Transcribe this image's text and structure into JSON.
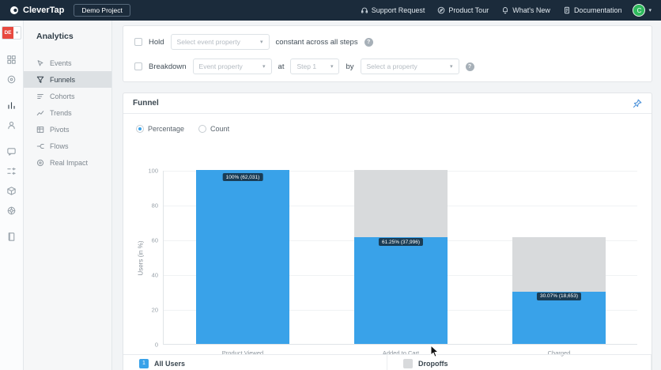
{
  "colors": {
    "topbar_bg": "#1b2b3b",
    "bar_blue": "#39a2e9",
    "bar_gray": "#d8dadc",
    "badge_red": "#e8493f",
    "avatar_green": "#2fb95d"
  },
  "topbar": {
    "logo_text": "CleverTap",
    "project_button": "Demo Project",
    "links": [
      {
        "label": "Support Request",
        "icon": "headset-icon"
      },
      {
        "label": "Product Tour",
        "icon": "compass-icon"
      },
      {
        "label": "What's New",
        "icon": "bell-icon"
      },
      {
        "label": "Documentation",
        "icon": "document-icon"
      }
    ],
    "avatar_initial": "C"
  },
  "rail": {
    "account_badge": "DE"
  },
  "sidebar": {
    "title": "Analytics",
    "items": [
      {
        "label": "Events"
      },
      {
        "label": "Funnels"
      },
      {
        "label": "Cohorts"
      },
      {
        "label": "Trends"
      },
      {
        "label": "Pivots"
      },
      {
        "label": "Flows"
      },
      {
        "label": "Real Impact"
      }
    ]
  },
  "filters": {
    "hold": {
      "label": "Hold",
      "placeholder": "Select event property",
      "suffix": "constant across all steps"
    },
    "breakdown": {
      "label": "Breakdown",
      "placeholder1": "Event property",
      "at": "at",
      "placeholder2": "Step 1",
      "by": "by",
      "placeholder3": "Select a property"
    }
  },
  "funnel_card": {
    "title": "Funnel",
    "radios": [
      {
        "label": "Percentage",
        "selected": true
      },
      {
        "label": "Count",
        "selected": false
      }
    ],
    "legend": [
      {
        "badge": "1",
        "label": "All Users"
      },
      {
        "badge": "",
        "label": "Dropoffs"
      }
    ]
  },
  "chart_data": {
    "type": "bar",
    "title": "Funnel",
    "categories": [
      "Product Viewed",
      "Added to Cart",
      "Charged"
    ],
    "series": [
      {
        "name": "All Users",
        "values_pct": [
          100,
          61.25,
          30.07
        ],
        "counts": [
          62031,
          37996,
          18653
        ]
      },
      {
        "name": "Dropoffs",
        "background_pct": [
          100,
          100,
          61.25
        ]
      }
    ],
    "bar_labels": [
      "100% (62,031)",
      "61.25% (37,996)",
      "30.07% (18,653)"
    ],
    "ylabel": "Users (in %)",
    "yticks": [
      0,
      20,
      40,
      60,
      80,
      100
    ],
    "ylim": [
      0,
      100
    ],
    "legend_position": "bottom",
    "grid": true
  }
}
